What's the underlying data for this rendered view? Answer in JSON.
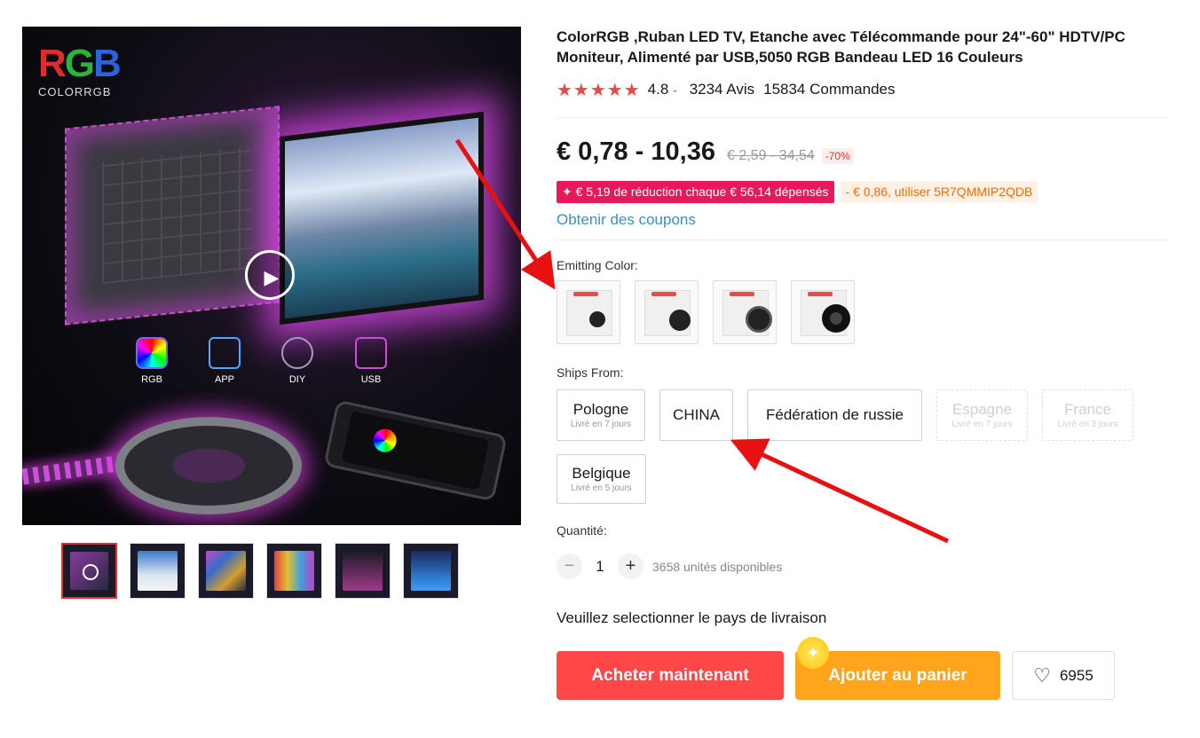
{
  "gallery": {
    "brand": {
      "logo_text": "RGB",
      "name": "COLORRGB"
    },
    "features": [
      {
        "label": "RGB",
        "icon": "color-wheel-icon"
      },
      {
        "label": "APP",
        "icon": "app-icon"
      },
      {
        "label": "DIY",
        "icon": "palette-icon"
      },
      {
        "label": "USB",
        "icon": "usb-icon"
      }
    ],
    "play_icon": "▶",
    "thumbnails": 6
  },
  "product": {
    "title": "ColorRGB ,Ruban LED TV, Etanche avec Télécommande pour 24\"-60\" HDTV/PC Moniteur, Alimenté par USB,5050 RGB Bandeau LED 16 Couleurs",
    "stars": "★★★★★",
    "rating": "4.8",
    "reviews": "3234 Avis",
    "orders": "15834 Commandes",
    "price": "€ 0,78 - 10,36",
    "price_old": "€ 2,59 - 34,54",
    "discount": "-70%",
    "promo_store": "✦ € 5,19 de réduction chaque € 56,14 dépensés",
    "promo_coupon": "- € 0,86, utiliser 5R7QMMIP2QDB",
    "coupon_link": "Obtenir des coupons",
    "color_label": "Emitting Color:",
    "ships_label": "Ships From:",
    "ships_options": [
      {
        "name": "Pologne",
        "sub": "Livré en 7 jours",
        "disabled": false
      },
      {
        "name": "CHINA",
        "sub": "",
        "disabled": false
      },
      {
        "name": "Fédération de russie",
        "sub": "",
        "disabled": false
      },
      {
        "name": "Espagne",
        "sub": "Livré en 7 jours",
        "disabled": true
      },
      {
        "name": "France",
        "sub": "Livré en 3 jours",
        "disabled": true
      },
      {
        "name": "Belgique",
        "sub": "Livré en 5 jours",
        "disabled": false
      }
    ],
    "qty_label": "Quantité:",
    "qty_value": "1",
    "qty_minus": "−",
    "qty_plus": "+",
    "qty_available": "3658 unités disponibles",
    "ship_note": "Veuillez selectionner le pays de livraison",
    "buy_label": "Acheter maintenant",
    "cart_label": "Ajouter au panier",
    "wishlist_count": "6955",
    "heart": "♡"
  },
  "colors": {
    "accent_red": "#ff4747",
    "cart_orange": "#ffa41c",
    "star_red": "#f04646",
    "link_blue": "#3e8fc0",
    "promo_pink": "#e8195a",
    "annotation_red": "#e81010"
  }
}
